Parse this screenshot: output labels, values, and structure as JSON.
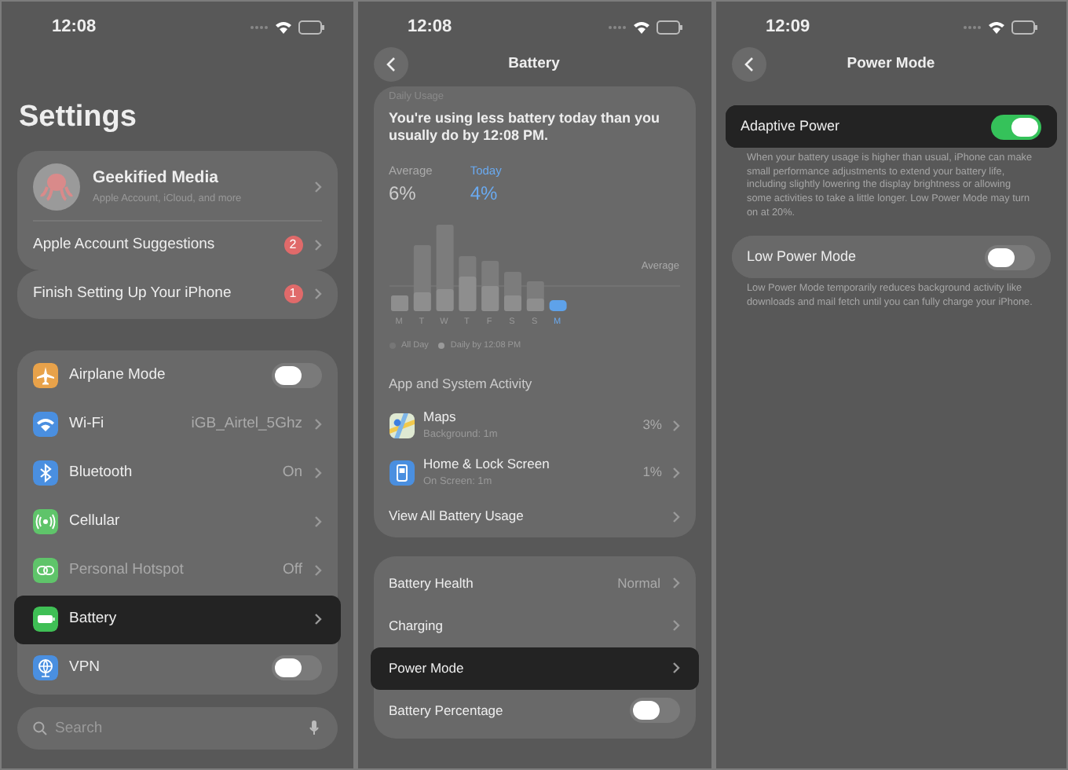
{
  "screens": [
    {
      "kind": "settings",
      "time": "12:08",
      "title": "Settings",
      "profile": {
        "name": "Geekified Media",
        "subtitle": "Apple Account, iCloud, and more"
      },
      "suggestions": {
        "label": "Apple Account Suggestions",
        "badge": "2"
      },
      "setup": {
        "label": "Finish Setting Up Your iPhone",
        "badge": "1"
      },
      "rows": [
        {
          "kind": "toggle",
          "color": "#e8a24a",
          "label": "Airplane Mode",
          "on": false,
          "selected": false,
          "disabled": false
        },
        {
          "kind": "link",
          "color": "#4a8fe0",
          "label": "Wi-Fi",
          "value": "iGB_Airtel_5Ghz",
          "selected": false,
          "disabled": false
        },
        {
          "kind": "link",
          "color": "#4a8fe0",
          "label": "Bluetooth",
          "value": "On",
          "selected": false,
          "disabled": false
        },
        {
          "kind": "link",
          "color": "#5fc46a",
          "label": "Cellular",
          "selected": false,
          "disabled": false
        },
        {
          "kind": "link",
          "color": "#5fc46a",
          "label": "Personal Hotspot",
          "value": "Off",
          "selected": false,
          "disabled": true
        },
        {
          "kind": "link",
          "color": "#3fbf55",
          "label": "Battery",
          "selected": true,
          "disabled": false
        },
        {
          "kind": "toggle",
          "color": "#4a8fe0",
          "label": "VPN",
          "on": false,
          "selected": false,
          "disabled": false
        }
      ],
      "search": {
        "placeholder": "Search"
      }
    },
    {
      "kind": "battery",
      "time": "12:08",
      "title": "Battery",
      "header": "Daily Usage",
      "message": "You're using less battery today than you usually do by 12:08 PM.",
      "stats": [
        {
          "label": "Average",
          "value": "6%",
          "today": false
        },
        {
          "label": "Today",
          "value": "4%",
          "today": true
        }
      ],
      "average_label": "Average",
      "days": [
        "M",
        "T",
        "W",
        "T",
        "F",
        "S",
        "S",
        "M"
      ],
      "legend": [
        "All Day",
        "Daily by 12:08 PM"
      ],
      "section": "App and System Activity",
      "apps": [
        {
          "name": "Maps",
          "detail": "Background: 1m",
          "value": "3%"
        },
        {
          "name": "Home & Lock Screen",
          "detail": "On Screen: 1m",
          "value": "1%"
        }
      ],
      "view_all": "View All Battery Usage",
      "rows": [
        {
          "kind": "link",
          "label": "Battery Health",
          "value": "Normal",
          "selected": false
        },
        {
          "kind": "link",
          "label": "Charging",
          "selected": false
        },
        {
          "kind": "link",
          "label": "Power Mode",
          "selected": true
        },
        {
          "kind": "toggle",
          "label": "Battery Percentage",
          "on": false,
          "selected": false
        }
      ]
    },
    {
      "kind": "power",
      "time": "12:09",
      "title": "Power Mode",
      "options": [
        {
          "label": "Adaptive Power",
          "on": true,
          "selected": true,
          "footnote": "When your battery usage is higher than usual, iPhone can make small performance adjustments to extend your battery life, including slightly lowering the display brightness or allowing some activities to take a little longer. Low Power Mode may turn on at 20%."
        },
        {
          "label": "Low Power Mode",
          "on": false,
          "selected": false,
          "footnote": "Low Power Mode temporarily reduces background activity like downloads and mail fetch until you can fully charge your iPhone."
        }
      ]
    }
  ]
}
